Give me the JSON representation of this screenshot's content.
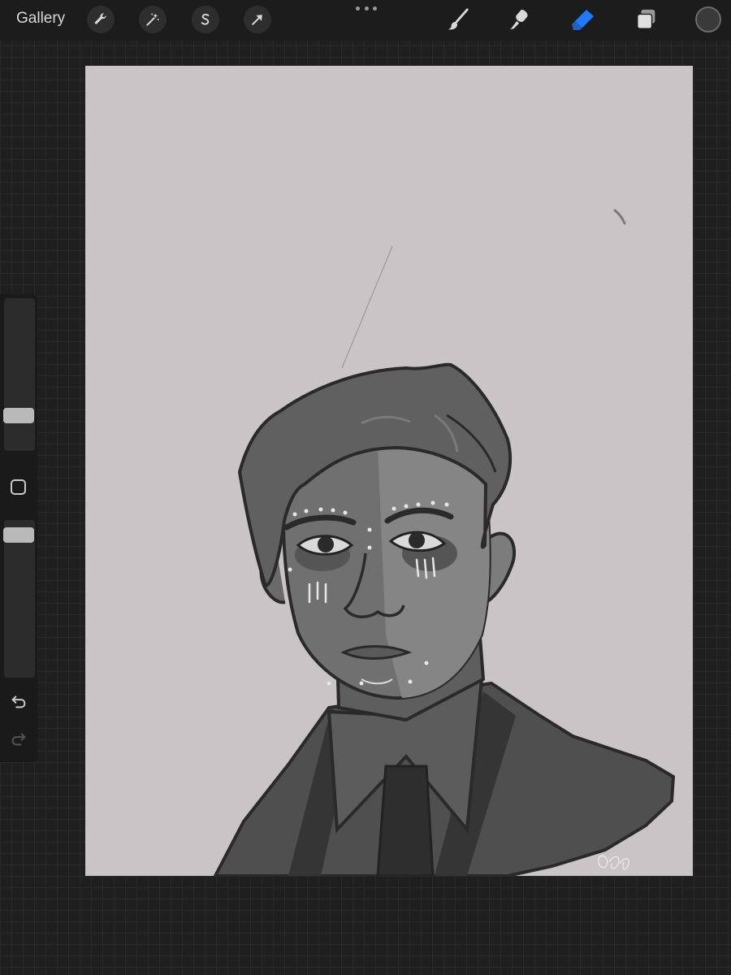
{
  "topbar": {
    "gallery_label": "Gallery",
    "left_tools": [
      {
        "icon": "wrench-icon",
        "name": "actions"
      },
      {
        "icon": "magic-wand-icon",
        "name": "adjustments"
      },
      {
        "icon": "selection-s-icon",
        "name": "selection"
      },
      {
        "icon": "arrow-cursor-icon",
        "name": "transform"
      }
    ],
    "more_icon": "more-dots-icon",
    "right_tools": [
      {
        "icon": "brush-icon",
        "name": "brush",
        "active": false
      },
      {
        "icon": "smudge-icon",
        "name": "smudge",
        "active": false
      },
      {
        "icon": "eraser-icon",
        "name": "eraser",
        "active": true
      },
      {
        "icon": "layers-icon",
        "name": "layers",
        "active": false
      }
    ],
    "color_icon": "color-swatch-icon"
  },
  "colors": {
    "accent": "#1e7bff",
    "canvas_bg": "#cbc4c6",
    "ui_bg": "#1f1f1f",
    "current_color": "#3a3a3a"
  },
  "sidebar": {
    "brush_size_level": 0.2,
    "opacity_level": 0.95,
    "modify_icon": "modify-square-icon",
    "undo_icon": "undo-icon",
    "redo_icon": "redo-icon"
  },
  "canvas": {
    "signature_icon": "artist-signature"
  }
}
